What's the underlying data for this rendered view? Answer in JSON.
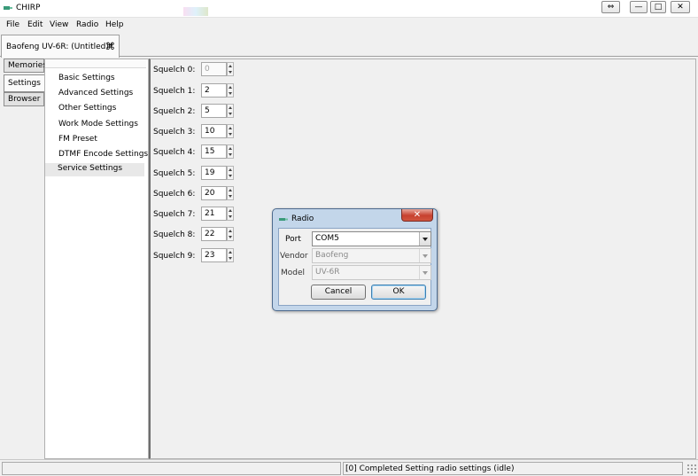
{
  "window": {
    "title": "CHIRP",
    "restore_glyph": "⇔",
    "minimize_glyph": "—",
    "maximize_glyph": "□",
    "close_glyph": "✕"
  },
  "menu": [
    "File",
    "Edit",
    "View",
    "Radio",
    "Help"
  ],
  "doc_tab": {
    "label": "Baofeng UV-6R: (Untitled)*",
    "close_glyph": "⌘"
  },
  "side_tabs": [
    "Memories",
    "Settings",
    "Browser"
  ],
  "tree": {
    "items": [
      "Basic Settings",
      "Advanced Settings",
      "Other Settings",
      "Work Mode Settings",
      "FM Preset",
      "DTMF Encode Settings",
      "Service Settings"
    ],
    "selected": "Service Settings"
  },
  "squelch": [
    {
      "label": "Squelch 0:",
      "value": "0"
    },
    {
      "label": "Squelch 1:",
      "value": "2"
    },
    {
      "label": "Squelch 2:",
      "value": "5"
    },
    {
      "label": "Squelch 3:",
      "value": "10"
    },
    {
      "label": "Squelch 4:",
      "value": "15"
    },
    {
      "label": "Squelch 5:",
      "value": "19"
    },
    {
      "label": "Squelch 6:",
      "value": "20"
    },
    {
      "label": "Squelch 7:",
      "value": "21"
    },
    {
      "label": "Squelch 8:",
      "value": "22"
    },
    {
      "label": "Squelch 9:",
      "value": "23"
    }
  ],
  "dialog": {
    "title": "Radio",
    "close_glyph": "✕",
    "port_label": "Port",
    "port_value": "COM5",
    "vendor_label": "Vendor",
    "vendor_value": "Baofeng",
    "model_label": "Model",
    "model_value": "UV-6R",
    "cancel_label": "Cancel",
    "ok_label": "OK"
  },
  "status": {
    "text": "[0] Completed Setting radio settings (idle)"
  },
  "colors": {
    "dialog_frame": "#c3d6ea",
    "close_red": "#c7412f",
    "app_icon": "#3a9a7a"
  }
}
